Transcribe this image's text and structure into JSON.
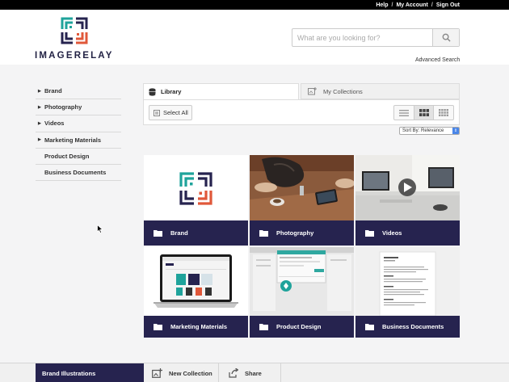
{
  "topbar": {
    "links": [
      "Help",
      "My Account",
      "Sign Out"
    ],
    "separator": "/"
  },
  "brand": {
    "name": "IMAGERELAY",
    "logo_icon": "imagerelay-logo-icon",
    "colors": {
      "teal": "#1fa39b",
      "orange": "#e0583a",
      "navy": "#26234f"
    }
  },
  "search": {
    "placeholder": "What are you looking for?",
    "value": "",
    "button_icon": "search-icon",
    "advanced_label": "Advanced Search"
  },
  "sidebar": {
    "items": [
      {
        "label": "Brand",
        "has_caret": true
      },
      {
        "label": "Photography",
        "has_caret": true
      },
      {
        "label": "Videos",
        "has_caret": true
      },
      {
        "label": "Marketing Materials",
        "has_caret": true
      },
      {
        "label": "Product Design",
        "has_caret": false
      },
      {
        "label": "Business Documents",
        "has_caret": false
      }
    ]
  },
  "tabs": {
    "library": "Library",
    "collections": "My Collections"
  },
  "toolbar": {
    "select_all": "Select All",
    "views": [
      "list-view-icon",
      "grid-view-icon",
      "small-grid-view-icon"
    ],
    "active_view": "grid-view-icon"
  },
  "sort": {
    "label": "Sort By:",
    "value": "Relevance"
  },
  "folders": [
    {
      "label": "Brand",
      "thumb": "brand-logo"
    },
    {
      "label": "Photography",
      "thumb": "desk-photo"
    },
    {
      "label": "Videos",
      "thumb": "video-thumbnail"
    },
    {
      "label": "Marketing Materials",
      "thumb": "laptop-website"
    },
    {
      "label": "Product Design",
      "thumb": "design-mockup"
    },
    {
      "label": "Business Documents",
      "thumb": "document-page"
    }
  ],
  "bottombar": {
    "active": "Brand Illustrations",
    "new_collection": "New Collection",
    "share": "Share"
  }
}
